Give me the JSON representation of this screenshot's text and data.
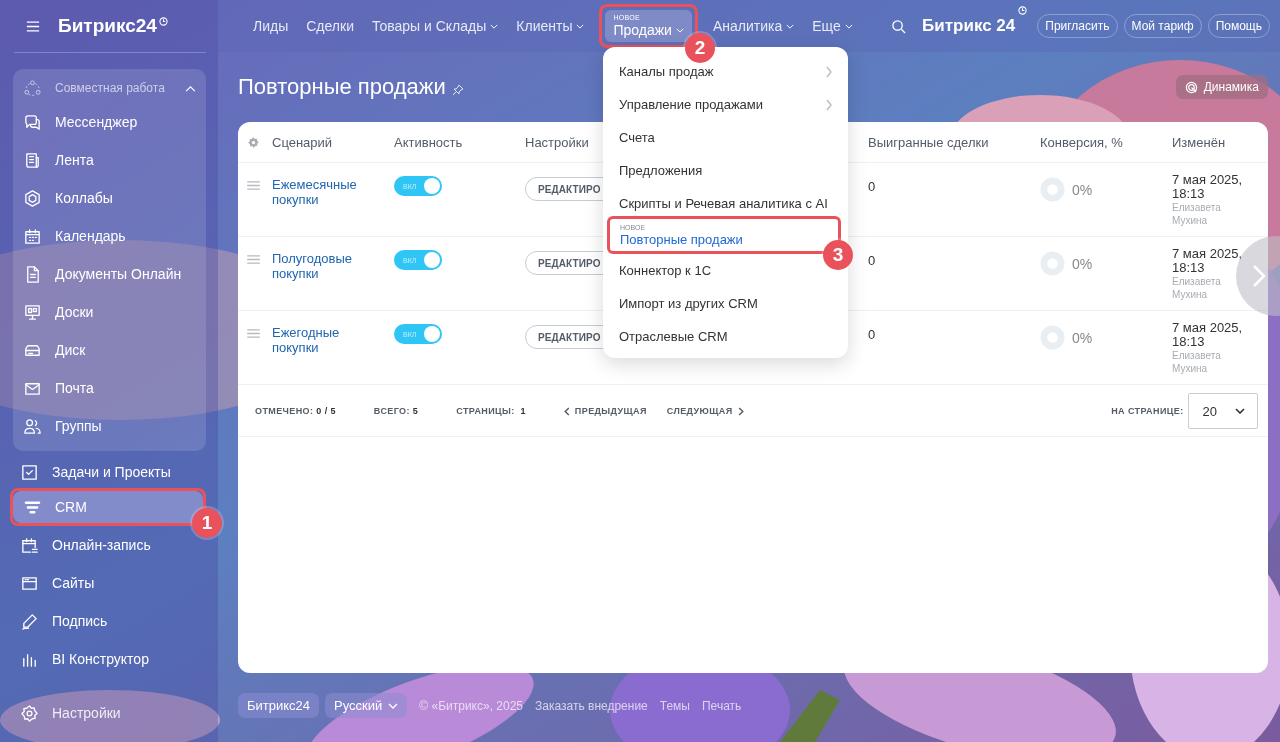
{
  "header": {
    "logo": "Битрикс24",
    "nav": [
      {
        "label": "Лиды",
        "caret": false,
        "selected": false
      },
      {
        "label": "Сделки",
        "caret": false,
        "selected": false
      },
      {
        "label": "Товары и Склады",
        "caret": true,
        "selected": false
      },
      {
        "label": "Клиенты",
        "caret": true,
        "selected": false
      },
      {
        "label": "Продажи",
        "caret": true,
        "selected": true,
        "badge": "НОВОЕ",
        "callout": "2"
      },
      {
        "label": "Аналитика",
        "caret": true,
        "selected": false
      },
      {
        "label": "Еще",
        "caret": true,
        "selected": false
      }
    ],
    "brand": "Битрикс 24",
    "buttons": [
      "Пригласить",
      "Мой тариф",
      "Помощь"
    ]
  },
  "sidebar": {
    "group": {
      "title": "Совместная работа",
      "expanded": true,
      "items": [
        {
          "label": "Мессенджер",
          "selected": false
        },
        {
          "label": "Лента",
          "selected": false
        },
        {
          "label": "Коллабы",
          "selected": false
        },
        {
          "label": "Календарь",
          "selected": false
        },
        {
          "label": "Документы Онлайн",
          "selected": false
        },
        {
          "label": "Доски",
          "selected": false
        },
        {
          "label": "Диск",
          "selected": false
        },
        {
          "label": "Почта",
          "selected": false
        },
        {
          "label": "Группы",
          "selected": false
        }
      ]
    },
    "items": [
      {
        "label": "Задачи и Проекты",
        "selected": false
      },
      {
        "label": "CRM",
        "selected": true,
        "callout": "1"
      },
      {
        "label": "Онлайн-запись",
        "selected": false
      },
      {
        "label": "Сайты",
        "selected": false
      },
      {
        "label": "Подпись",
        "selected": false
      },
      {
        "label": "BI Конструктор",
        "selected": false
      }
    ],
    "settings": "Настройки"
  },
  "page": {
    "title": "Повторные продажи",
    "dynamics_button": "Динамика"
  },
  "table": {
    "columns": [
      "Сценарий",
      "Активность",
      "Настройки",
      "Выигранные сделки",
      "Конверсия, %",
      "Изменён"
    ],
    "rows": [
      {
        "name": "Ежемесячные покупки",
        "on": true,
        "toggle_label": "ВКЛ",
        "edit": "РЕДАКТИРО",
        "won": "0",
        "conversion": "0%",
        "changed": "7 мая 2025, 18:13",
        "author": "Елизавета Мухина"
      },
      {
        "name": "Полугодовые покупки",
        "on": true,
        "toggle_label": "ВКЛ",
        "edit": "РЕДАКТИРО",
        "won": "0",
        "conversion": "0%",
        "changed": "7 мая 2025, 18:13",
        "author": "Елизавета Мухина"
      },
      {
        "name": "Ежегодные покупки",
        "on": true,
        "toggle_label": "ВКЛ",
        "edit": "РЕДАКТИРО",
        "won": "0",
        "conversion": "0%",
        "changed": "7 мая 2025, 18:13",
        "author": "Елизавета Мухина"
      }
    ],
    "footer": {
      "checked_label": "ОТМЕЧЕНО:",
      "checked": "0 / 5",
      "total_label": "ВСЕГО:",
      "total": "5",
      "pages_label": "СТРАНИЦЫ:",
      "pages": "1",
      "prev": "ПРЕДЫДУЩАЯ",
      "next": "СЛЕДУЮЩАЯ",
      "per_page_label": "НА СТРАНИЦЕ:",
      "per_page": "20"
    }
  },
  "menu": {
    "items": [
      {
        "label": "Каналы продаж",
        "submenu": true,
        "selected": false
      },
      {
        "label": "Управление продажами",
        "submenu": true,
        "selected": false
      },
      {
        "label": "Счета",
        "submenu": false,
        "selected": false
      },
      {
        "label": "Предложения",
        "submenu": false,
        "selected": false
      },
      {
        "label": "Скрипты и Речевая аналитика с AI",
        "submenu": false,
        "selected": false
      },
      {
        "label": "Повторные продажи",
        "submenu": false,
        "selected": true,
        "badge": "НОВОЕ",
        "callout": "3"
      },
      {
        "label": "Коннектор к 1С",
        "submenu": false,
        "selected": false
      },
      {
        "label": "Импорт из других CRM",
        "submenu": false,
        "selected": false
      },
      {
        "label": "Отраслевые CRM",
        "submenu": false,
        "selected": false
      }
    ]
  },
  "footer": {
    "logo": "Битрикс24",
    "language": "Русский",
    "copyright": "© «Битрикс», 2025",
    "links": [
      "Заказать внедрение",
      "Темы",
      "Печать"
    ]
  }
}
